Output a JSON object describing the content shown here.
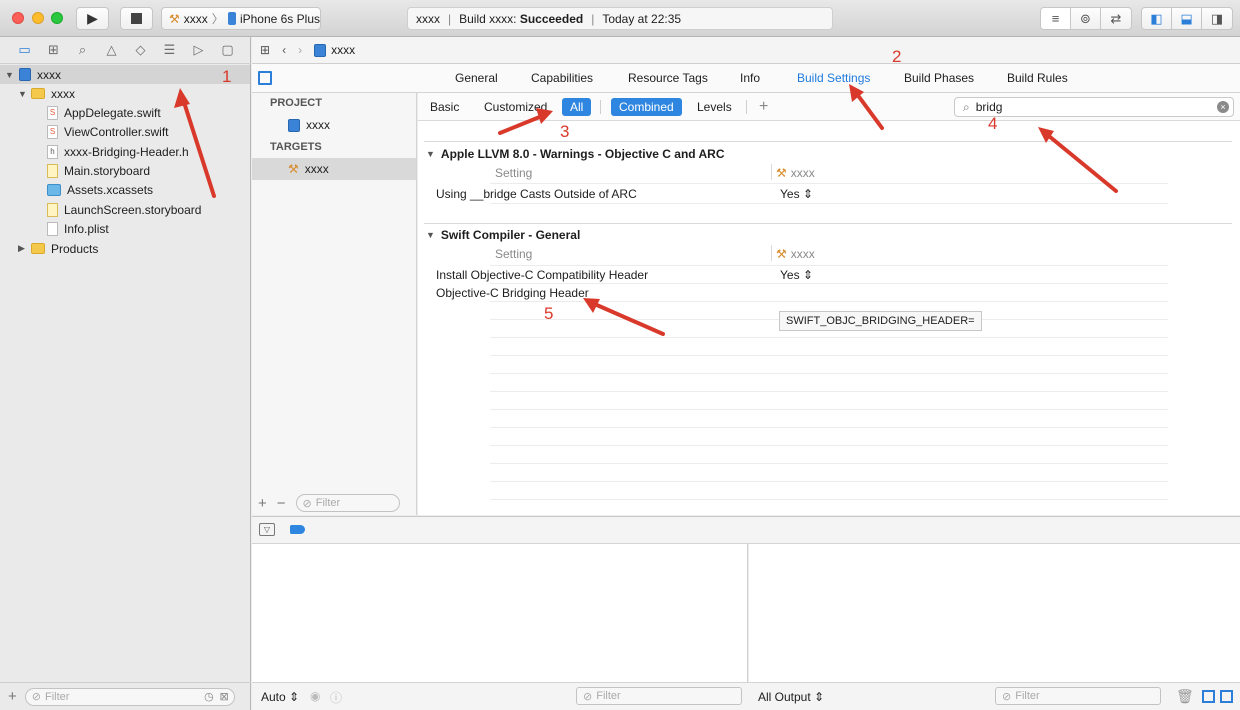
{
  "toolbar": {
    "scheme": "xxxx",
    "device": "iPhone 6s Plus",
    "status_project": "xxxx",
    "status_build_prefix": "Build xxxx:",
    "status_result": "Succeeded",
    "status_time": "Today at 22:35"
  },
  "navigator": {
    "project": "xxxx",
    "group": "xxxx",
    "files": [
      "AppDelegate.swift",
      "ViewController.swift",
      "xxxx-Bridging-Header.h",
      "Main.storyboard",
      "Assets.xcassets",
      "LaunchScreen.storyboard",
      "Info.plist"
    ],
    "products": "Products",
    "filter_placeholder": "Filter"
  },
  "jumpbar": {
    "file": "xxxx"
  },
  "tabs": [
    "General",
    "Capabilities",
    "Resource Tags",
    "Info",
    "Build Settings",
    "Build Phases",
    "Build Rules"
  ],
  "targets_panel": {
    "project_header": "PROJECT",
    "project_item": "xxxx",
    "targets_header": "TARGETS",
    "target_item": "xxxx",
    "filter_placeholder": "Filter"
  },
  "filterbar": {
    "basic": "Basic",
    "customized": "Customized",
    "all": "All",
    "combined": "Combined",
    "levels": "Levels",
    "search_value": "bridg"
  },
  "sections": [
    {
      "title": "Apple LLVM 8.0 - Warnings - Objective C and ARC",
      "setting_header": "Setting",
      "target_header": "xxxx",
      "rows": [
        {
          "name": "Using __bridge Casts Outside of ARC",
          "value": "Yes ⇕"
        }
      ]
    },
    {
      "title": "Swift Compiler - General",
      "setting_header": "Setting",
      "target_header": "xxxx",
      "rows": [
        {
          "name": "Install Objective-C Compatibility Header",
          "value": "Yes ⇕"
        },
        {
          "name": "Objective-C Bridging Header",
          "value": ""
        }
      ]
    }
  ],
  "tooltip": "SWIFT_OBJC_BRIDGING_HEADER=",
  "debug": {
    "auto": "Auto ⇕",
    "filter_placeholder": "Filter",
    "all_output": "All Output ⇕"
  },
  "annotations": [
    "1",
    "2",
    "3",
    "4",
    "5"
  ],
  "colors": {
    "accent": "#2f86e0",
    "annotation": "#d9392b"
  }
}
